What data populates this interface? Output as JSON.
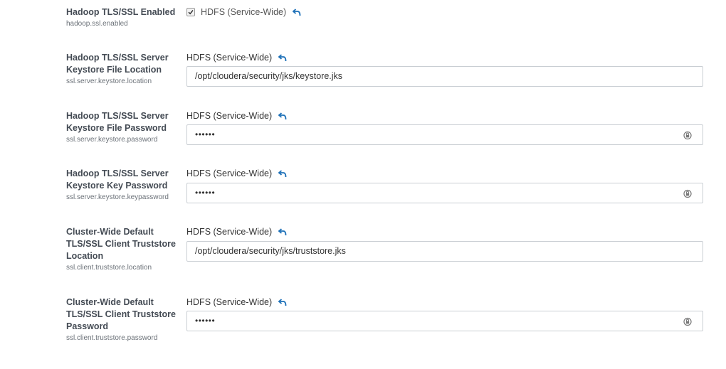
{
  "properties": [
    {
      "name": "Hadoop TLS/SSL Enabled",
      "key": "hadoop.ssl.enabled",
      "scope": "HDFS (Service-Wide)",
      "checked": true
    },
    {
      "name_lines": [
        "Hadoop TLS/SSL Server",
        "Keystore File Location"
      ],
      "key": "ssl.server.keystore.location",
      "scope": "HDFS (Service-Wide)",
      "value": "/opt/cloudera/security/jks/keystore.jks"
    },
    {
      "name_lines": [
        "Hadoop TLS/SSL Server",
        "Keystore File Password"
      ],
      "key": "ssl.server.keystore.password",
      "scope": "HDFS (Service-Wide)",
      "masked_value": "••••••"
    },
    {
      "name_lines": [
        "Hadoop TLS/SSL Server",
        "Keystore Key Password"
      ],
      "key": "ssl.server.keystore.keypassword",
      "scope": "HDFS (Service-Wide)",
      "masked_value": "••••••"
    },
    {
      "name_lines": [
        "Cluster-Wide Default",
        "TLS/SSL Client Truststore",
        "Location"
      ],
      "key": "ssl.client.truststore.location",
      "scope": "HDFS (Service-Wide)",
      "value": "/opt/cloudera/security/jks/truststore.jks"
    },
    {
      "name_lines": [
        "Cluster-Wide Default",
        "TLS/SSL Client Truststore",
        "Password"
      ],
      "key": "ssl.client.truststore.password",
      "scope": "HDFS (Service-Wide)",
      "masked_value": "••••••"
    }
  ],
  "icons": {
    "undo": "undo-arrow-icon",
    "reveal": "reveal-password-icon"
  },
  "colors": {
    "accent": "#1d70b8",
    "label": "#444b54",
    "border": "#c9ced3"
  }
}
